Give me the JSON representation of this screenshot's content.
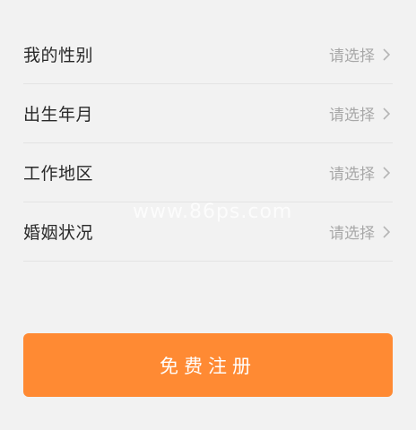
{
  "form": {
    "rows": [
      {
        "label": "我的性别",
        "value": "请选择"
      },
      {
        "label": "出生年月",
        "value": "请选择"
      },
      {
        "label": "工作地区",
        "value": "请选择"
      },
      {
        "label": "婚姻状况",
        "value": "请选择"
      }
    ]
  },
  "watermark": "www.86ps.com",
  "register_button": {
    "label": "免费注册",
    "color": "#ff8a33"
  },
  "icons": {
    "row_chevron": "chevron-right-icon"
  }
}
